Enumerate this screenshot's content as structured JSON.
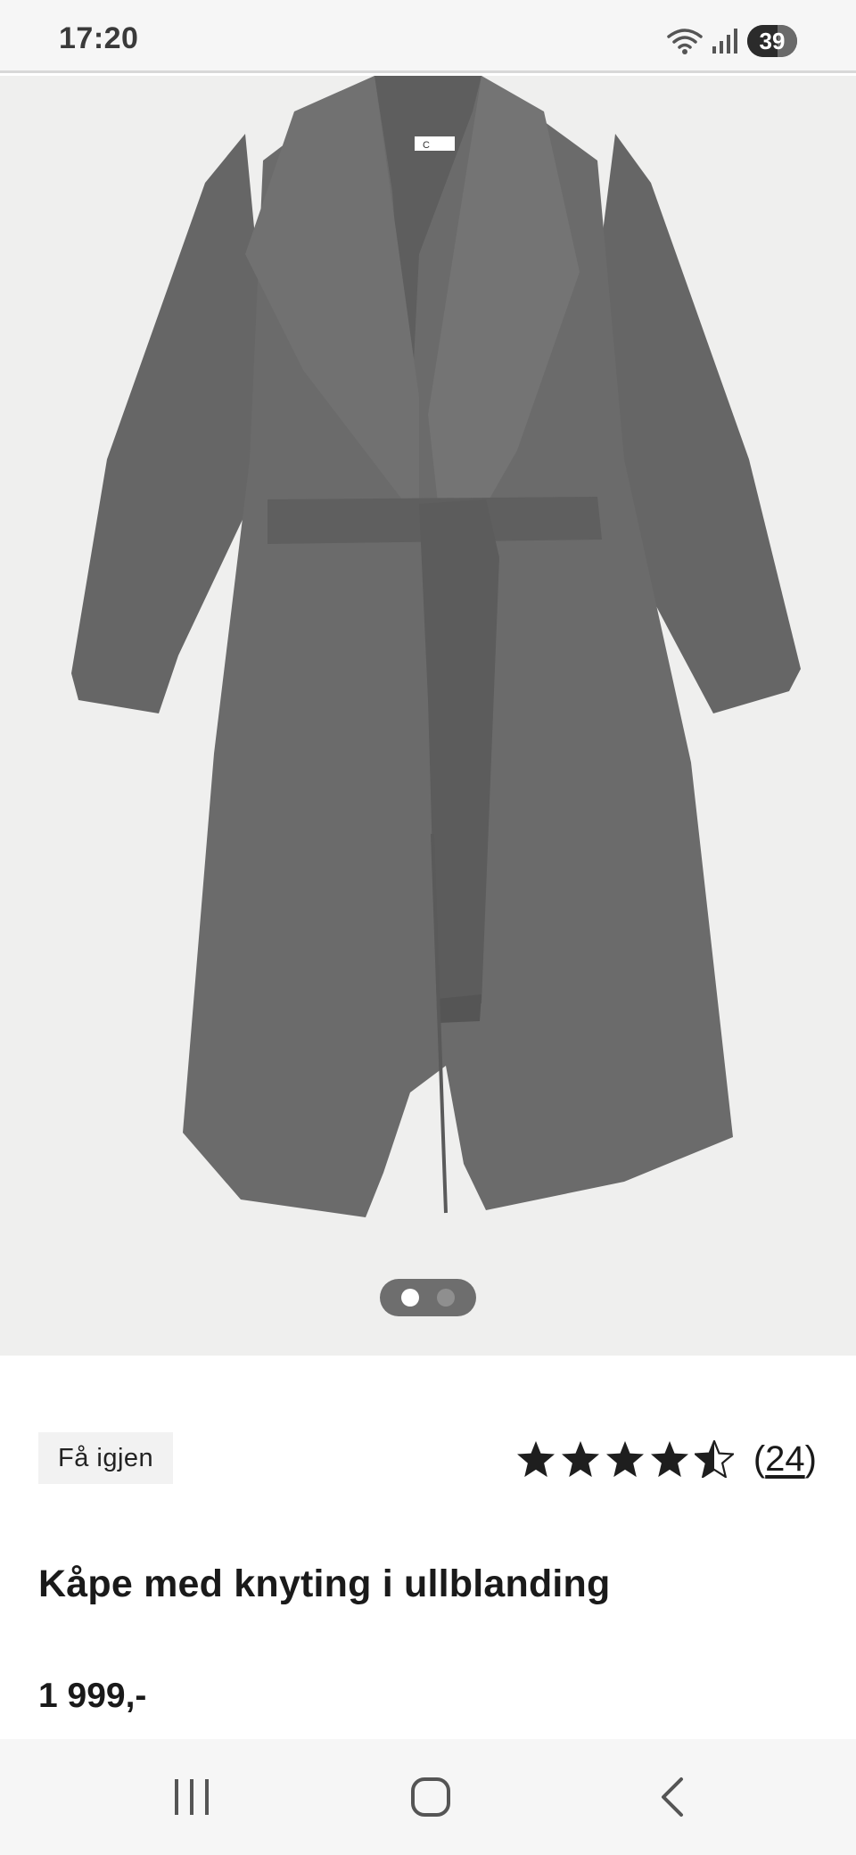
{
  "status_bar": {
    "time": "17:20",
    "battery": "39",
    "icons": [
      "wifi-icon",
      "signal-icon",
      "battery-icon"
    ]
  },
  "carousel": {
    "image": "grey-wool-wrap-coat-image",
    "total": 2,
    "active_index": 1
  },
  "product": {
    "badge": "Få igjen",
    "rating": 4.5,
    "rating_max": 5,
    "review_count": "24",
    "review_open": "(",
    "review_close": ")",
    "title": "Kåpe med knyting i ullblanding",
    "price": "1 999,-"
  },
  "nav": {
    "buttons": [
      "recent-apps-icon",
      "home-icon",
      "back-icon"
    ]
  },
  "colors": {
    "text": "#1a1a1a",
    "image_bg": "#efefee",
    "coat": "#6a6a6a",
    "badge_bg": "#f2f2f2"
  }
}
